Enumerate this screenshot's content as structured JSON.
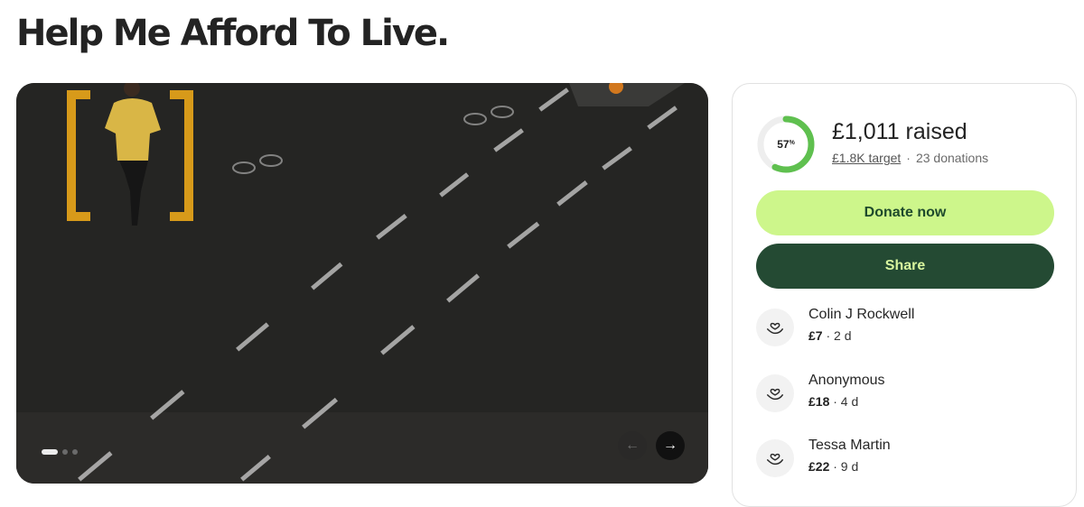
{
  "page": {
    "title": "Help Me Afford To Live."
  },
  "carousel": {
    "image_description_icon": "photo-road-runner",
    "slide_count": 3,
    "active_slide": 1,
    "prev_icon": "arrow-left-icon",
    "next_icon": "arrow-right-icon"
  },
  "fundraiser": {
    "progress_percent": 57,
    "progress_pct_text": "57",
    "progress_pct_sign": "%",
    "raised_text": "£1,011 raised",
    "target_text": "£1.8K target",
    "separator": "·",
    "donations_text": "23 donations",
    "donate_label": "Donate now",
    "share_label": "Share",
    "colors": {
      "ring": "#5fc04f",
      "ring_track": "#eeeeee",
      "donate_bg": "#cdf68b",
      "share_bg": "#244a33"
    }
  },
  "donations": [
    {
      "name": "Colin J Rockwell",
      "amount": "£7",
      "time": "· 2 d",
      "icon": "heart-hand-icon"
    },
    {
      "name": "Anonymous",
      "amount": "£18",
      "time": "· 4 d",
      "icon": "heart-hand-icon"
    },
    {
      "name": "Tessa Martin",
      "amount": "£22",
      "time": "· 9 d",
      "icon": "heart-hand-icon"
    }
  ]
}
